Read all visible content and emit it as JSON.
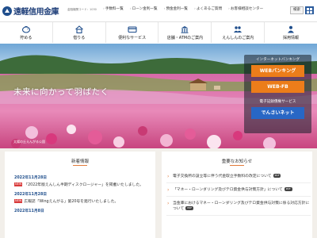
{
  "header": {
    "logo_text": "遠軽信用金庫",
    "bank_code": "金融機関コード：1030",
    "links": [
      "手数料一覧",
      "ローン金利一覧",
      "預金金利一覧",
      "よくあるご質問",
      "お客様相談センター"
    ],
    "search_label": "検索",
    "sitemap_icon": "grid-icon"
  },
  "nav": {
    "items": [
      {
        "label": "貯める",
        "icon": "piggy-bank-icon"
      },
      {
        "label": "借りる",
        "icon": "house-icon"
      },
      {
        "label": "便利なサービス",
        "icon": "card-icon"
      },
      {
        "label": "店舗・ATMのご案内",
        "icon": "building-icon"
      },
      {
        "label": "えんしんのご案内",
        "icon": "people-icon"
      },
      {
        "label": "採用情報",
        "icon": "person-icon"
      }
    ]
  },
  "hero": {
    "tagline": "未来に向かって羽ばたく",
    "caption": "太陽の丘えんがる公園"
  },
  "internet_panel": {
    "heading": "インターネットバンキング",
    "web_banking": "WEBバンキング",
    "web_fb": "WEB-FB",
    "ebank_heading": "電子記録債権サービス",
    "densai": "でんさいネット"
  },
  "colors": {
    "brand": "#1f4e8c",
    "orange_button": "#ec7d1a",
    "blue_button": "#2867c5",
    "accent": "#e27a3a",
    "new_badge": "#d93b3b"
  },
  "news": {
    "title": "新着情報",
    "items": [
      {
        "date": "2022年11月28日",
        "badge": "NEW",
        "text": "「2022年版えんしん半期ディスクロージャー」を掲載いたしました。"
      },
      {
        "date": "2022年11月28日",
        "badge": "NEW",
        "text": "広報誌「Wingえんがる」第20号を発行いたしました。"
      },
      {
        "date": "2022年11月8日",
        "badge": "",
        "text": ""
      }
    ]
  },
  "important": {
    "title": "重要なお知らせ",
    "items": [
      {
        "text": "電子交換所の設立等に伴う代金取立手数料の改定について",
        "pdf": "PDF"
      },
      {
        "text": "「マネー・ローンダリング及びテロ資金供与対策方針」について",
        "pdf": "PDF"
      },
      {
        "text": "当金庫におけるマネー・ローンダリング及びテロ資金供与対策に係る対応方針について",
        "pdf": "PDF"
      }
    ]
  }
}
